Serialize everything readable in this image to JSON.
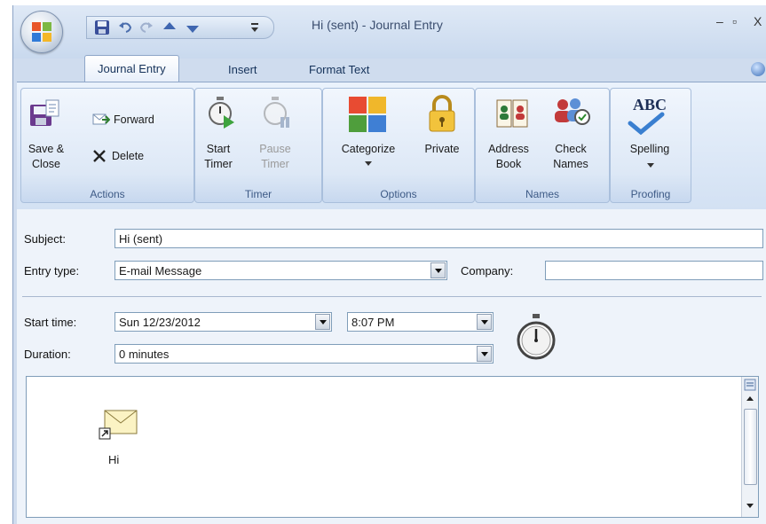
{
  "window": {
    "title": "Hi (sent) - Journal Entry",
    "controls": [
      "–",
      "▫",
      "X"
    ]
  },
  "tabs": [
    {
      "label": "Journal Entry",
      "active": true
    },
    {
      "label": "Insert",
      "active": false
    },
    {
      "label": "Format Text",
      "active": false
    }
  ],
  "ribbon": {
    "actions": {
      "label": "Actions",
      "save_close": "Save &\nClose",
      "forward": "Forward",
      "delete": "Delete"
    },
    "timer": {
      "label": "Timer",
      "start_timer": "Start\nTimer",
      "pause_timer": "Pause\nTimer"
    },
    "options": {
      "label": "Options",
      "categorize": "Categorize",
      "private": "Private"
    },
    "names": {
      "label": "Names",
      "address_book": "Address\nBook",
      "check_names": "Check\nNames"
    },
    "proofing": {
      "label": "Proofing",
      "spelling": "Spelling",
      "abc": "ABC"
    }
  },
  "form": {
    "subject_label": "Subject:",
    "subject_value": "Hi (sent)",
    "entry_type_label": "Entry type:",
    "entry_type_value": "E-mail Message",
    "company_label": "Company:",
    "company_value": "",
    "start_time_label": "Start time:",
    "start_date_value": "Sun 12/23/2012",
    "start_time_value": "8:07 PM",
    "duration_label": "Duration:",
    "duration_value": "0 minutes"
  },
  "body": {
    "attachment_label": "Hi"
  }
}
